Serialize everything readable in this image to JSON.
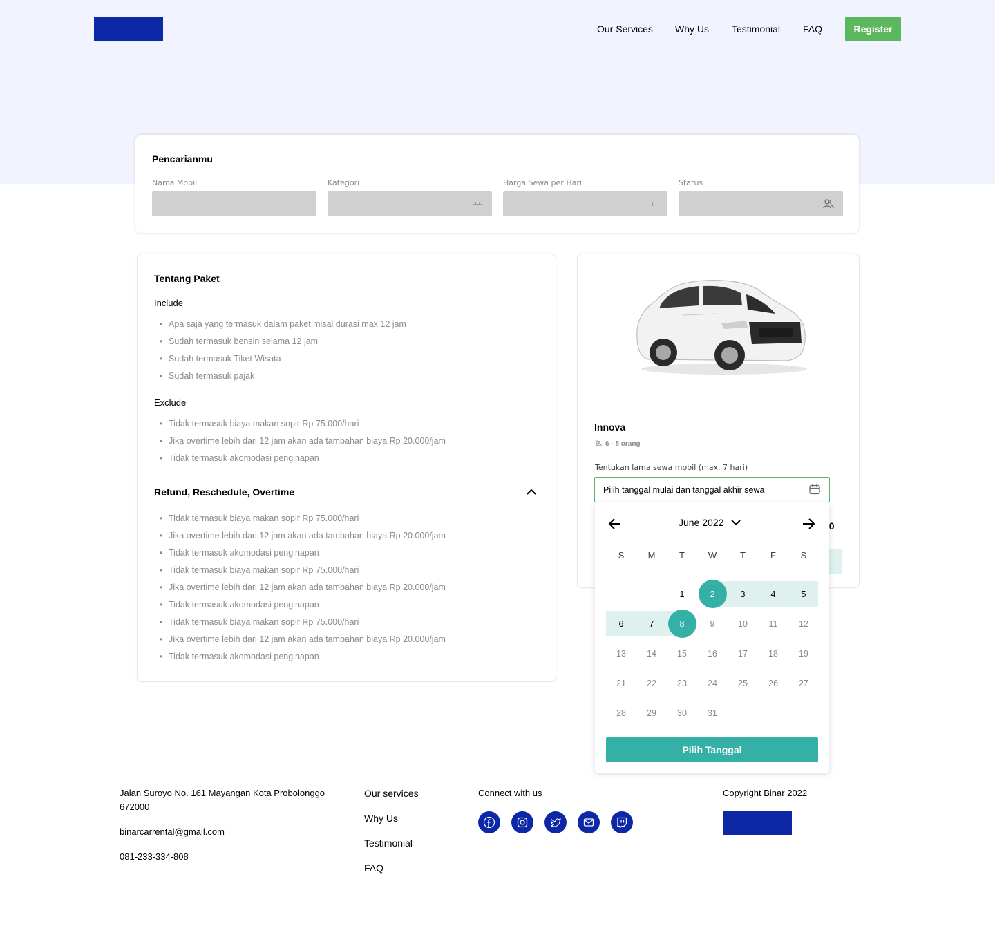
{
  "header": {
    "nav": [
      "Our Services",
      "Why Us",
      "Testimonial",
      "FAQ"
    ],
    "register_label": "Register"
  },
  "search": {
    "title": "Pencarianmu",
    "fields": [
      {
        "label": "Nama Mobil",
        "value": ""
      },
      {
        "label": "Kategori",
        "value": ""
      },
      {
        "label": "Harga Sewa per Hari",
        "value": ""
      },
      {
        "label": "Status",
        "value": ""
      }
    ]
  },
  "package": {
    "title": "Tentang Paket",
    "include_label": "Include",
    "include": [
      "Apa saja yang termasuk dalam paket misal durasi max 12 jam",
      "Sudah termasuk bensin selama 12 jam",
      "Sudah termasuk Tiket Wisata",
      "Sudah termasuk pajak"
    ],
    "exclude_label": "Exclude",
    "exclude": [
      "Tidak termasuk biaya makan sopir Rp 75.000/hari",
      "Jika overtime lebih dari 12 jam akan ada tambahan biaya Rp 20.000/jam",
      "Tidak termasuk akomodasi penginapan"
    ],
    "refund_title": "Refund, Reschedule, Overtime",
    "refund": [
      "Tidak termasuk biaya makan sopir Rp 75.000/hari",
      "Jika overtime lebih dari 12 jam akan ada tambahan biaya Rp 20.000/jam",
      "Tidak termasuk akomodasi penginapan",
      "Tidak termasuk biaya makan sopir Rp 75.000/hari",
      "Jika overtime lebih dari 12 jam akan ada tambahan biaya Rp 20.000/jam",
      "Tidak termasuk akomodasi penginapan",
      "Tidak termasuk biaya makan sopir Rp 75.000/hari",
      "Jika overtime lebih dari 12 jam akan ada tambahan biaya Rp 20.000/jam",
      "Tidak termasuk akomodasi penginapan"
    ]
  },
  "car": {
    "name": "Innova",
    "capacity": "6 - 8 orang",
    "sewa_label": "Tentukan lama sewa mobil (max. 7 hari)",
    "date_placeholder": "Pilih tanggal mulai dan tanggal akhir sewa",
    "price_partial": "00"
  },
  "calendar": {
    "month_label": "June 2022",
    "weekdays": [
      "S",
      "M",
      "T",
      "W",
      "T",
      "F",
      "S"
    ],
    "weeks": [
      [
        "",
        "",
        "1",
        "2",
        "3",
        "4",
        "5"
      ],
      [
        "6",
        "7",
        "8",
        "9",
        "10",
        "11",
        "12"
      ],
      [
        "13",
        "14",
        "15",
        "16",
        "17",
        "18",
        "19"
      ],
      [
        "21",
        "22",
        "23",
        "24",
        "25",
        "26",
        "27"
      ],
      [
        "28",
        "29",
        "30",
        "31",
        "",
        "",
        ""
      ]
    ],
    "selected_start": "2",
    "selected_end": "8",
    "button_label": "Pilih Tanggal"
  },
  "footer": {
    "address_line1": "Jalan Suroyo No. 161 Mayangan Kota Probolonggo",
    "address_line2": "672000",
    "email": "binarcarrental@gmail.com",
    "phone": "081-233-334-808",
    "links": [
      "Our services",
      "Why Us",
      "Testimonial",
      "FAQ"
    ],
    "connect_label": "Connect with us",
    "social_icons": [
      "facebook-icon",
      "instagram-icon",
      "twitter-icon",
      "mail-icon",
      "twitch-icon"
    ],
    "copyright": "Copyright Binar 2022"
  },
  "colors": {
    "brand": "#0D28A6",
    "accent": "#35B0A7",
    "register": "#5CB85F",
    "hero_bg": "#F1F3FF"
  }
}
